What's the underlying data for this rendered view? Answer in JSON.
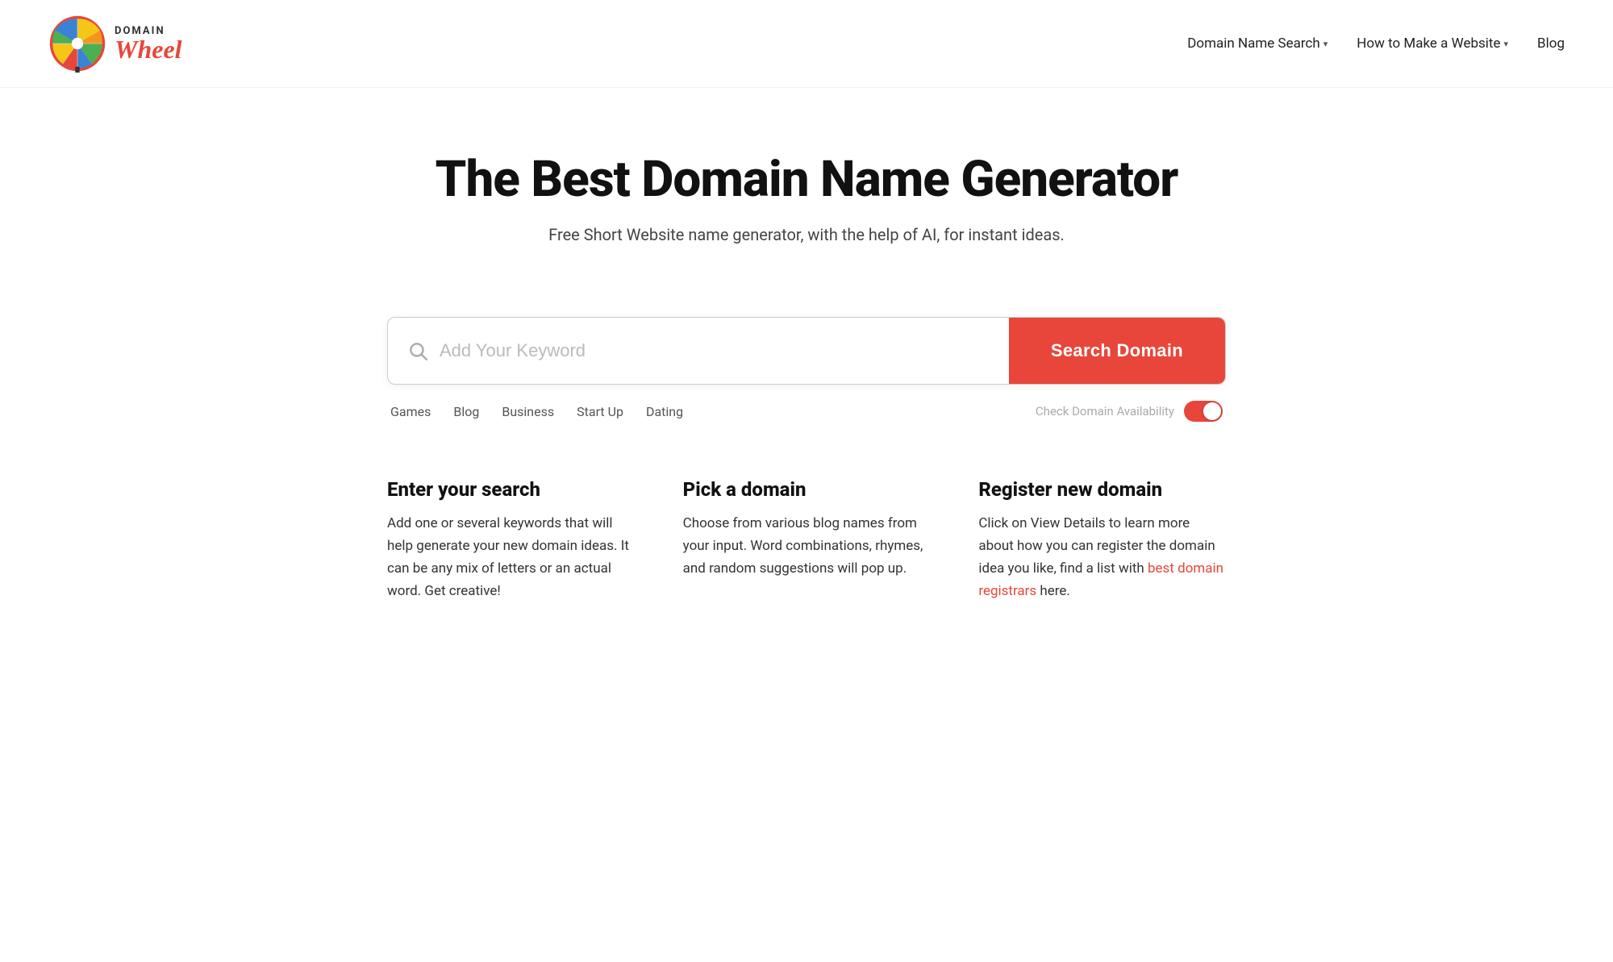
{
  "header": {
    "logo_domain": "DOMAIN",
    "logo_wheel": "Wheel",
    "nav": [
      {
        "id": "domain-name-search",
        "label": "Domain Name Search",
        "has_dropdown": true
      },
      {
        "id": "how-to-make-website",
        "label": "How to Make a Website",
        "has_dropdown": true
      },
      {
        "id": "blog",
        "label": "Blog",
        "has_dropdown": false
      }
    ]
  },
  "hero": {
    "title": "The Best Domain Name Generator",
    "subtitle": "Free Short Website name generator, with the help of AI, for instant ideas."
  },
  "search": {
    "placeholder": "Add Your Keyword",
    "button_label": "Search Domain",
    "quick_tags": [
      {
        "id": "games",
        "label": "Games"
      },
      {
        "id": "blog",
        "label": "Blog"
      },
      {
        "id": "business",
        "label": "Business"
      },
      {
        "id": "startup",
        "label": "Start Up"
      },
      {
        "id": "dating",
        "label": "Dating"
      }
    ],
    "toggle_label": "Check Domain Availability",
    "toggle_enabled": true
  },
  "how_it_works": [
    {
      "id": "enter-search",
      "title": "Enter your search",
      "text": "Add one or several keywords that will help generate your new domain ideas. It can be any mix of letters or an actual word. Get creative!"
    },
    {
      "id": "pick-domain",
      "title": "Pick a domain",
      "text": "Choose from various blog names from your input. Word combinations, rhymes, and random suggestions will pop up."
    },
    {
      "id": "register-domain",
      "title": "Register new domain",
      "text_before_link": "Click on View Details to learn more about how you can register the domain idea you like, find a list with ",
      "link_text": "best domain registrars",
      "text_after_link": " here."
    }
  ],
  "colors": {
    "accent": "#e8463a",
    "text_primary": "#111111",
    "text_secondary": "#444444",
    "text_muted": "#aaaaaa"
  }
}
